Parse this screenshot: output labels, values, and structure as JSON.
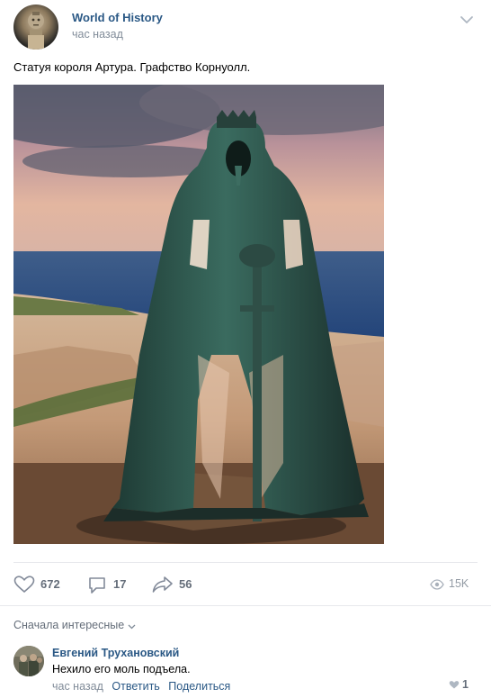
{
  "post": {
    "author": "World of History",
    "time": "час назад",
    "text": "Статуя короля Артура. Графство Корнуолл."
  },
  "actions": {
    "likes": "672",
    "comments": "17",
    "shares": "56",
    "views": "15K"
  },
  "comments": {
    "sort_label": "Сначала интересные",
    "items": [
      {
        "author": "Евгений Трухановский",
        "text": "Нехило его моль подъела.",
        "time": "час назад",
        "reply_label": "Ответить",
        "share_label": "Поделиться",
        "likes": "1"
      }
    ]
  },
  "icons": {
    "menu": "chevron-down-icon",
    "like": "heart-icon",
    "comment": "comment-bubble-icon",
    "share": "share-arrow-icon",
    "views": "eye-icon",
    "comment_like": "heart-icon"
  },
  "colors": {
    "link": "#2a5885",
    "secondary_text": "#818c99",
    "action_text": "#656e7a",
    "divider": "#e7e8ec"
  }
}
